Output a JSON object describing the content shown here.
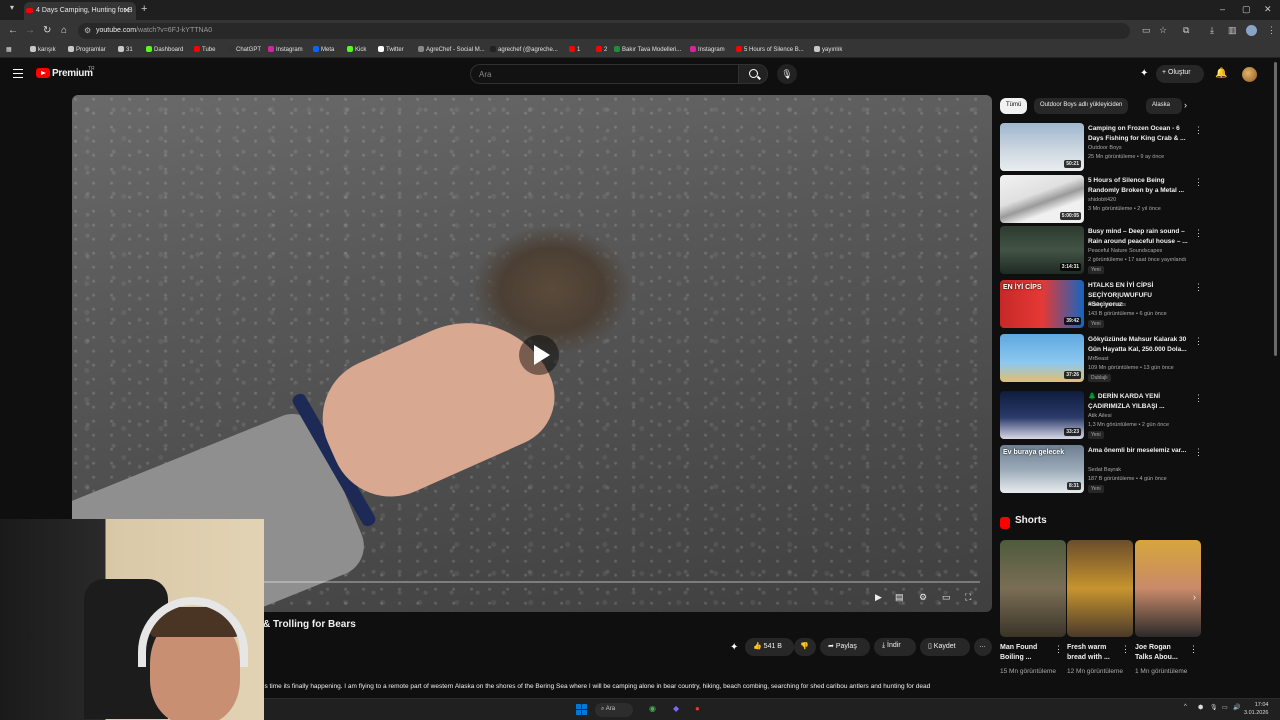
{
  "browser": {
    "tab_title": "4 Days Camping, Hunting for B",
    "new_tab": "+",
    "url_host": "youtube.com",
    "url_path": "/watch?v=6FJ-kYTTNA0",
    "bookmarks": [
      {
        "label": "karışık",
        "icon": "folder-icon"
      },
      {
        "label": "Programlar",
        "icon": "folder-icon"
      },
      {
        "label": "31",
        "icon": "folder-icon"
      },
      {
        "label": "Dashboard",
        "icon": "kick-icon"
      },
      {
        "label": "Tube",
        "icon": "youtube-icon"
      },
      {
        "label": "ChatGPT",
        "icon": "chatgpt-icon"
      },
      {
        "label": "Instagram",
        "icon": "instagram-icon"
      },
      {
        "label": "Meta",
        "icon": "meta-icon"
      },
      {
        "label": "Kick",
        "icon": "kick-icon"
      },
      {
        "label": "Twitter",
        "icon": "x-icon"
      },
      {
        "label": "AgreChef - Social M...",
        "icon": "agrechef-icon"
      },
      {
        "label": "agrechef (@agreche...",
        "icon": "tiktok-icon"
      },
      {
        "label": "1",
        "icon": "youtube-icon"
      },
      {
        "label": "2",
        "icon": "youtube-icon"
      },
      {
        "label": "Bakır Tava Modelleri...",
        "icon": "site-icon"
      },
      {
        "label": "Instagram",
        "icon": "instagram-icon"
      },
      {
        "label": "5 Hours of Silence B...",
        "icon": "youtube-icon"
      },
      {
        "label": "yayınlık",
        "icon": "folder-icon"
      }
    ]
  },
  "youtube": {
    "brand": "Premium",
    "brand_region": "TR",
    "search_placeholder": "Ara",
    "create_label": "Oluştur",
    "video_title": "& Trolling for Bears",
    "actions": {
      "likes": "541 B",
      "share": "Paylaş",
      "download": "İndir",
      "save": "Kaydet",
      "more": "…"
    },
    "description": "is time its finally happening. I am flying to a remote part of western Alaska on the shores of the Bering Sea where I will be camping alone in bear country, hiking, beach combing, searching for shed caribou antlers and hunting for dead",
    "chips": [
      "Tümü",
      "Outdoor Boys adlı yükleyiciden",
      "Alaska"
    ],
    "recommendations": [
      {
        "title": "Camping on Frozen Ocean - 6 Days Fishing for King Crab & ...",
        "channel": "Outdoor Boys",
        "meta": "25 Mn görüntüleme • 9 ay önce",
        "duration": "50:21",
        "badge": ""
      },
      {
        "title": "5 Hours of Silence Being Randomly Broken by a Metal ...",
        "channel": "shidobit420",
        "meta": "3 Mn görüntüleme • 2 yıl önce",
        "duration": "5:00:05",
        "badge": ""
      },
      {
        "title": "Busy mind – Deep rain sound – Rain around peaceful house – ...",
        "channel": "Peaceful Nature Soundscapes",
        "meta": "2 görüntüleme • 17 saat önce yayınlandı",
        "duration": "3:14:31",
        "badge": "Yeni"
      },
      {
        "title": "HTALKS EN İYİ CİPSİ SEÇİYOR|UWUFUFU #Seçiyoruz",
        "channel": "Htalksmoments",
        "meta": "143 B görüntüleme • 6 gün önce",
        "duration": "39:42",
        "badge": "Yeni"
      },
      {
        "title": "Gökyüzünde Mahsur Kalarak 30 Gün Hayatta Kal, 250.000 Dola...",
        "channel": "MrBeast",
        "meta": "109 Mn görüntüleme • 13 gün önce",
        "duration": "37:26",
        "badge": "Dublajlı"
      },
      {
        "title": "🌲 DERİN KARDA YENİ ÇADIRIMIZLA YILBAŞI ...",
        "channel": "Atik Ailesi",
        "meta": "1,3 Mn görüntüleme • 2 gün önce",
        "duration": "33:23",
        "badge": "Yeni"
      },
      {
        "title": "Ama önemli bir meselemiz var...",
        "channel": "Sedat Bayrak",
        "meta": "187 B görüntüleme • 4 gün önce",
        "duration": "8:31",
        "badge": "Yeni"
      }
    ],
    "thumb_texts": [
      "",
      "",
      "",
      "EN İYİ CİPS",
      "",
      "",
      "Ev buraya gelecek"
    ],
    "shorts_label": "Shorts",
    "shorts": [
      {
        "title": "Man Found Boiling ...",
        "views": "15 Mn görüntüleme"
      },
      {
        "title": "Fresh warm bread with ...",
        "views": "12 Mn görüntüleme"
      },
      {
        "title": "Joe Rogan Talks Abou...",
        "views": "1 Mn görüntüleme"
      }
    ]
  },
  "taskbar": {
    "search_label": "Ara",
    "time": "17:04",
    "date": "3.01.2026"
  }
}
